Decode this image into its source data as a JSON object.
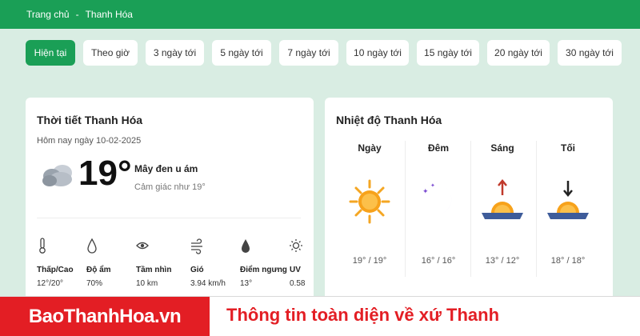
{
  "breadcrumb": {
    "home": "Trang chủ",
    "separator": "-",
    "current": "Thanh Hóa"
  },
  "tabs": [
    "Hiện tại",
    "Theo giờ",
    "3 ngày tới",
    "5 ngày tới",
    "7 ngày tới",
    "10 ngày tới",
    "15 ngày tới",
    "20 ngày tới",
    "30 ngày tới"
  ],
  "current": {
    "title": "Thời tiết Thanh Hóa",
    "date": "Hôm nay ngày 10-02-2025",
    "icon": "cloud-icon",
    "temp": "19°",
    "condition": "Mây đen u ám",
    "feels_like": "Cảm giác như 19°",
    "stats": [
      {
        "icon": "thermometer-icon",
        "label": "Thấp/Cao",
        "value": "12°/20°"
      },
      {
        "icon": "droplet-icon",
        "label": "Độ ẩm",
        "value": "70%"
      },
      {
        "icon": "eye-icon",
        "label": "Tầm nhìn",
        "value": "10 km"
      },
      {
        "icon": "wind-icon",
        "label": "Gió",
        "value": "3.94 km/h"
      },
      {
        "icon": "dewpoint-icon",
        "label": "Điểm ngưng",
        "value": "13°"
      },
      {
        "icon": "uv-icon",
        "label": "UV",
        "value": "0.58"
      }
    ]
  },
  "temperature": {
    "title": "Nhiệt độ Thanh Hóa",
    "periods": [
      {
        "name": "Ngày",
        "icon": "sun-icon",
        "temp": "19° / 19°"
      },
      {
        "name": "Đêm",
        "icon": "moon-icon",
        "temp": "16° / 16°"
      },
      {
        "name": "Sáng",
        "icon": "sunrise-icon",
        "temp": "13° / 12°"
      },
      {
        "name": "Tối",
        "icon": "sunset-icon",
        "temp": "18° / 18°"
      }
    ]
  },
  "banner": {
    "brand": "BaoThanhHoa.vn",
    "tagline": "Thông tin toàn diện về xứ Thanh"
  },
  "colors": {
    "accent": "#1a9f56",
    "brand_red": "#e31e24",
    "background": "#d9ede3"
  }
}
